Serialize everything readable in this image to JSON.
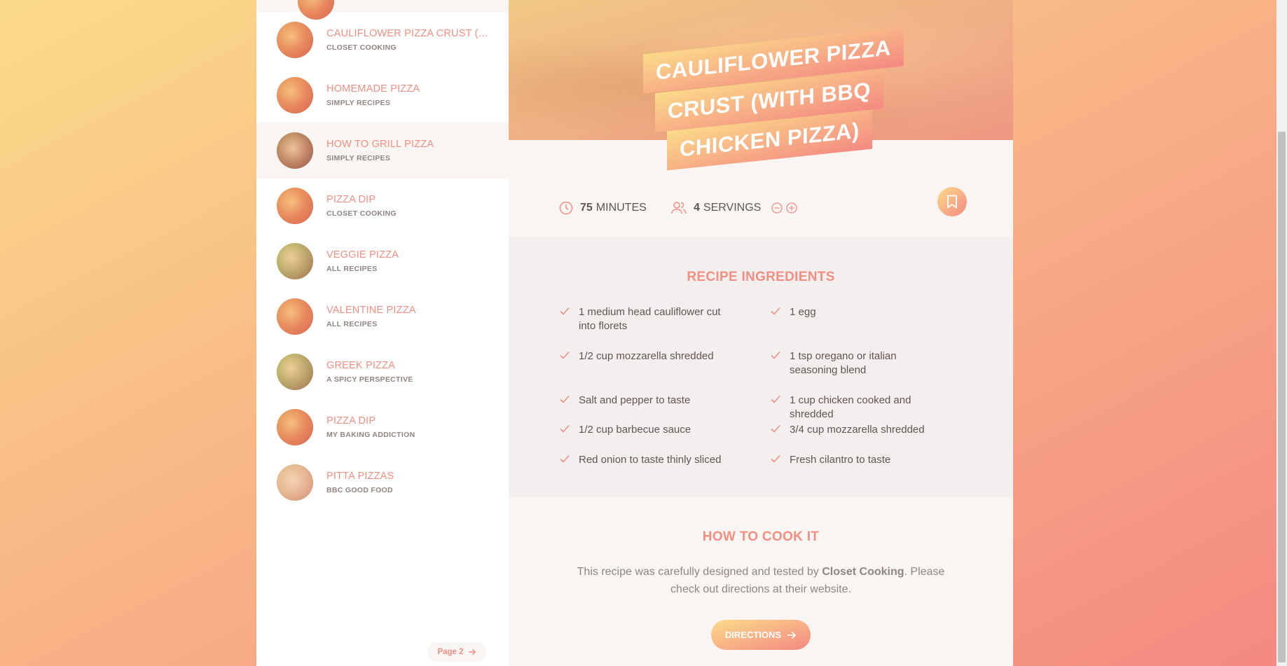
{
  "results": [
    {
      "title": "Cauliflower Pizza Crust (with BBQ Chicken Pizza)",
      "publisher": "Closet Cooking",
      "thumb": "red"
    },
    {
      "title": "Homemade Pizza",
      "publisher": "Simply Recipes",
      "thumb": "red"
    },
    {
      "title": "How to Grill Pizza",
      "publisher": "Simply Recipes",
      "thumb": "dark",
      "active": true
    },
    {
      "title": "Pizza Dip",
      "publisher": "Closet Cooking",
      "thumb": "red"
    },
    {
      "title": "Veggie Pizza",
      "publisher": "All Recipes",
      "thumb": "green"
    },
    {
      "title": "Valentine Pizza",
      "publisher": "All Recipes",
      "thumb": "red"
    },
    {
      "title": "Greek Pizza",
      "publisher": "A Spicy Perspective",
      "thumb": "green"
    },
    {
      "title": "Pizza Dip",
      "publisher": "My Baking Addiction",
      "thumb": "red"
    },
    {
      "title": "Pitta Pizzas",
      "publisher": "BBC Good Food",
      "thumb": "pale"
    }
  ],
  "pagination": {
    "label": "Page 2"
  },
  "recipe": {
    "title_lines": [
      "Cauliflower Pizza",
      "Crust (with BBQ",
      "Chicken Pizza)"
    ],
    "minutes": "75",
    "minutes_label": "minutes",
    "servings": "4",
    "servings_label": "servings",
    "ingredients_heading": "Recipe Ingredients",
    "ingredients": [
      "1 medium head cauliflower cut into florets",
      "1 egg",
      "1/2 cup mozzarella shredded",
      "1 tsp oregano or italian seasoning blend",
      "Salt and pepper to taste",
      "1 cup chicken cooked and shredded",
      "1/2 cup barbecue sauce",
      "3/4 cup mozzarella shredded",
      "Red onion to taste thinly sliced",
      "Fresh cilantro to taste"
    ],
    "directions_heading": "How to cook it",
    "directions_text_pre": "This recipe was carefully designed and tested by ",
    "directions_publisher": "Closet Cooking",
    "directions_text_post": ". Please check out directions at their website.",
    "directions_button": "Directions"
  },
  "colors": {
    "accent": "#f38e82",
    "gradient_start": "#fbdb89",
    "gradient_end": "#f48982"
  }
}
